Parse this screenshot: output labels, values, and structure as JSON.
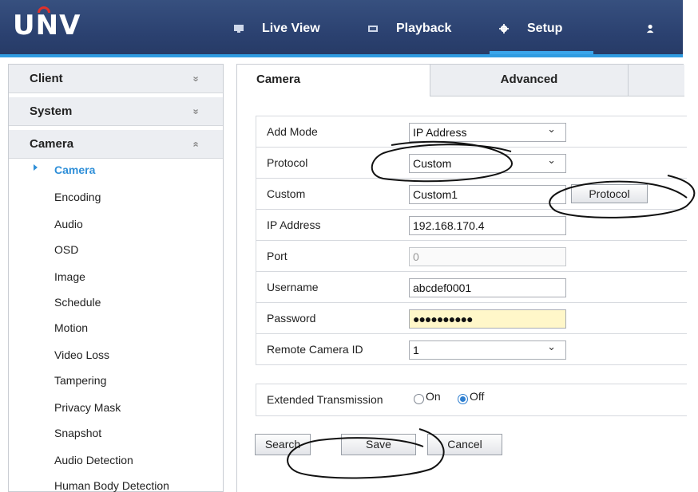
{
  "brand": {
    "logo_text": "UNV",
    "accent": "#2f9be0",
    "logo_arc": "#e0312b"
  },
  "nav": {
    "live_view": "Live View",
    "playback": "Playback",
    "setup": "Setup"
  },
  "sidebar": {
    "groups": [
      {
        "label": "Client",
        "chevron": "»"
      },
      {
        "label": "System",
        "chevron": "»"
      },
      {
        "label": "Camera",
        "chevron": "«"
      }
    ],
    "items": [
      "Camera",
      "Encoding",
      "Audio",
      "OSD",
      "Image",
      "Schedule",
      "Motion",
      "Video Loss",
      "Tampering",
      "Privacy Mask",
      "Snapshot",
      "Audio Detection",
      "Human Body Detection"
    ],
    "active_item": "Camera"
  },
  "tabs": {
    "camera": "Camera",
    "advanced": "Advanced"
  },
  "form": {
    "add_mode": {
      "label": "Add Mode",
      "value": "IP Address"
    },
    "protocol": {
      "label": "Protocol",
      "value": "Custom"
    },
    "custom": {
      "label": "Custom",
      "value": "Custom1",
      "button": "Protocol"
    },
    "ip_address": {
      "label": "IP Address",
      "value": "192.168.170.4"
    },
    "port": {
      "label": "Port",
      "value": "0"
    },
    "username": {
      "label": "Username",
      "value": "abcdef0001"
    },
    "password": {
      "label": "Password",
      "value": "●●●●●●●●●●"
    },
    "remote_camera_id": {
      "label": "Remote Camera ID",
      "value": "1"
    }
  },
  "extended": {
    "label": "Extended Transmission",
    "on": "On",
    "off": "Off",
    "selected": "Off"
  },
  "actions": {
    "search": "Search",
    "save": "Save",
    "cancel": "Cancel"
  }
}
